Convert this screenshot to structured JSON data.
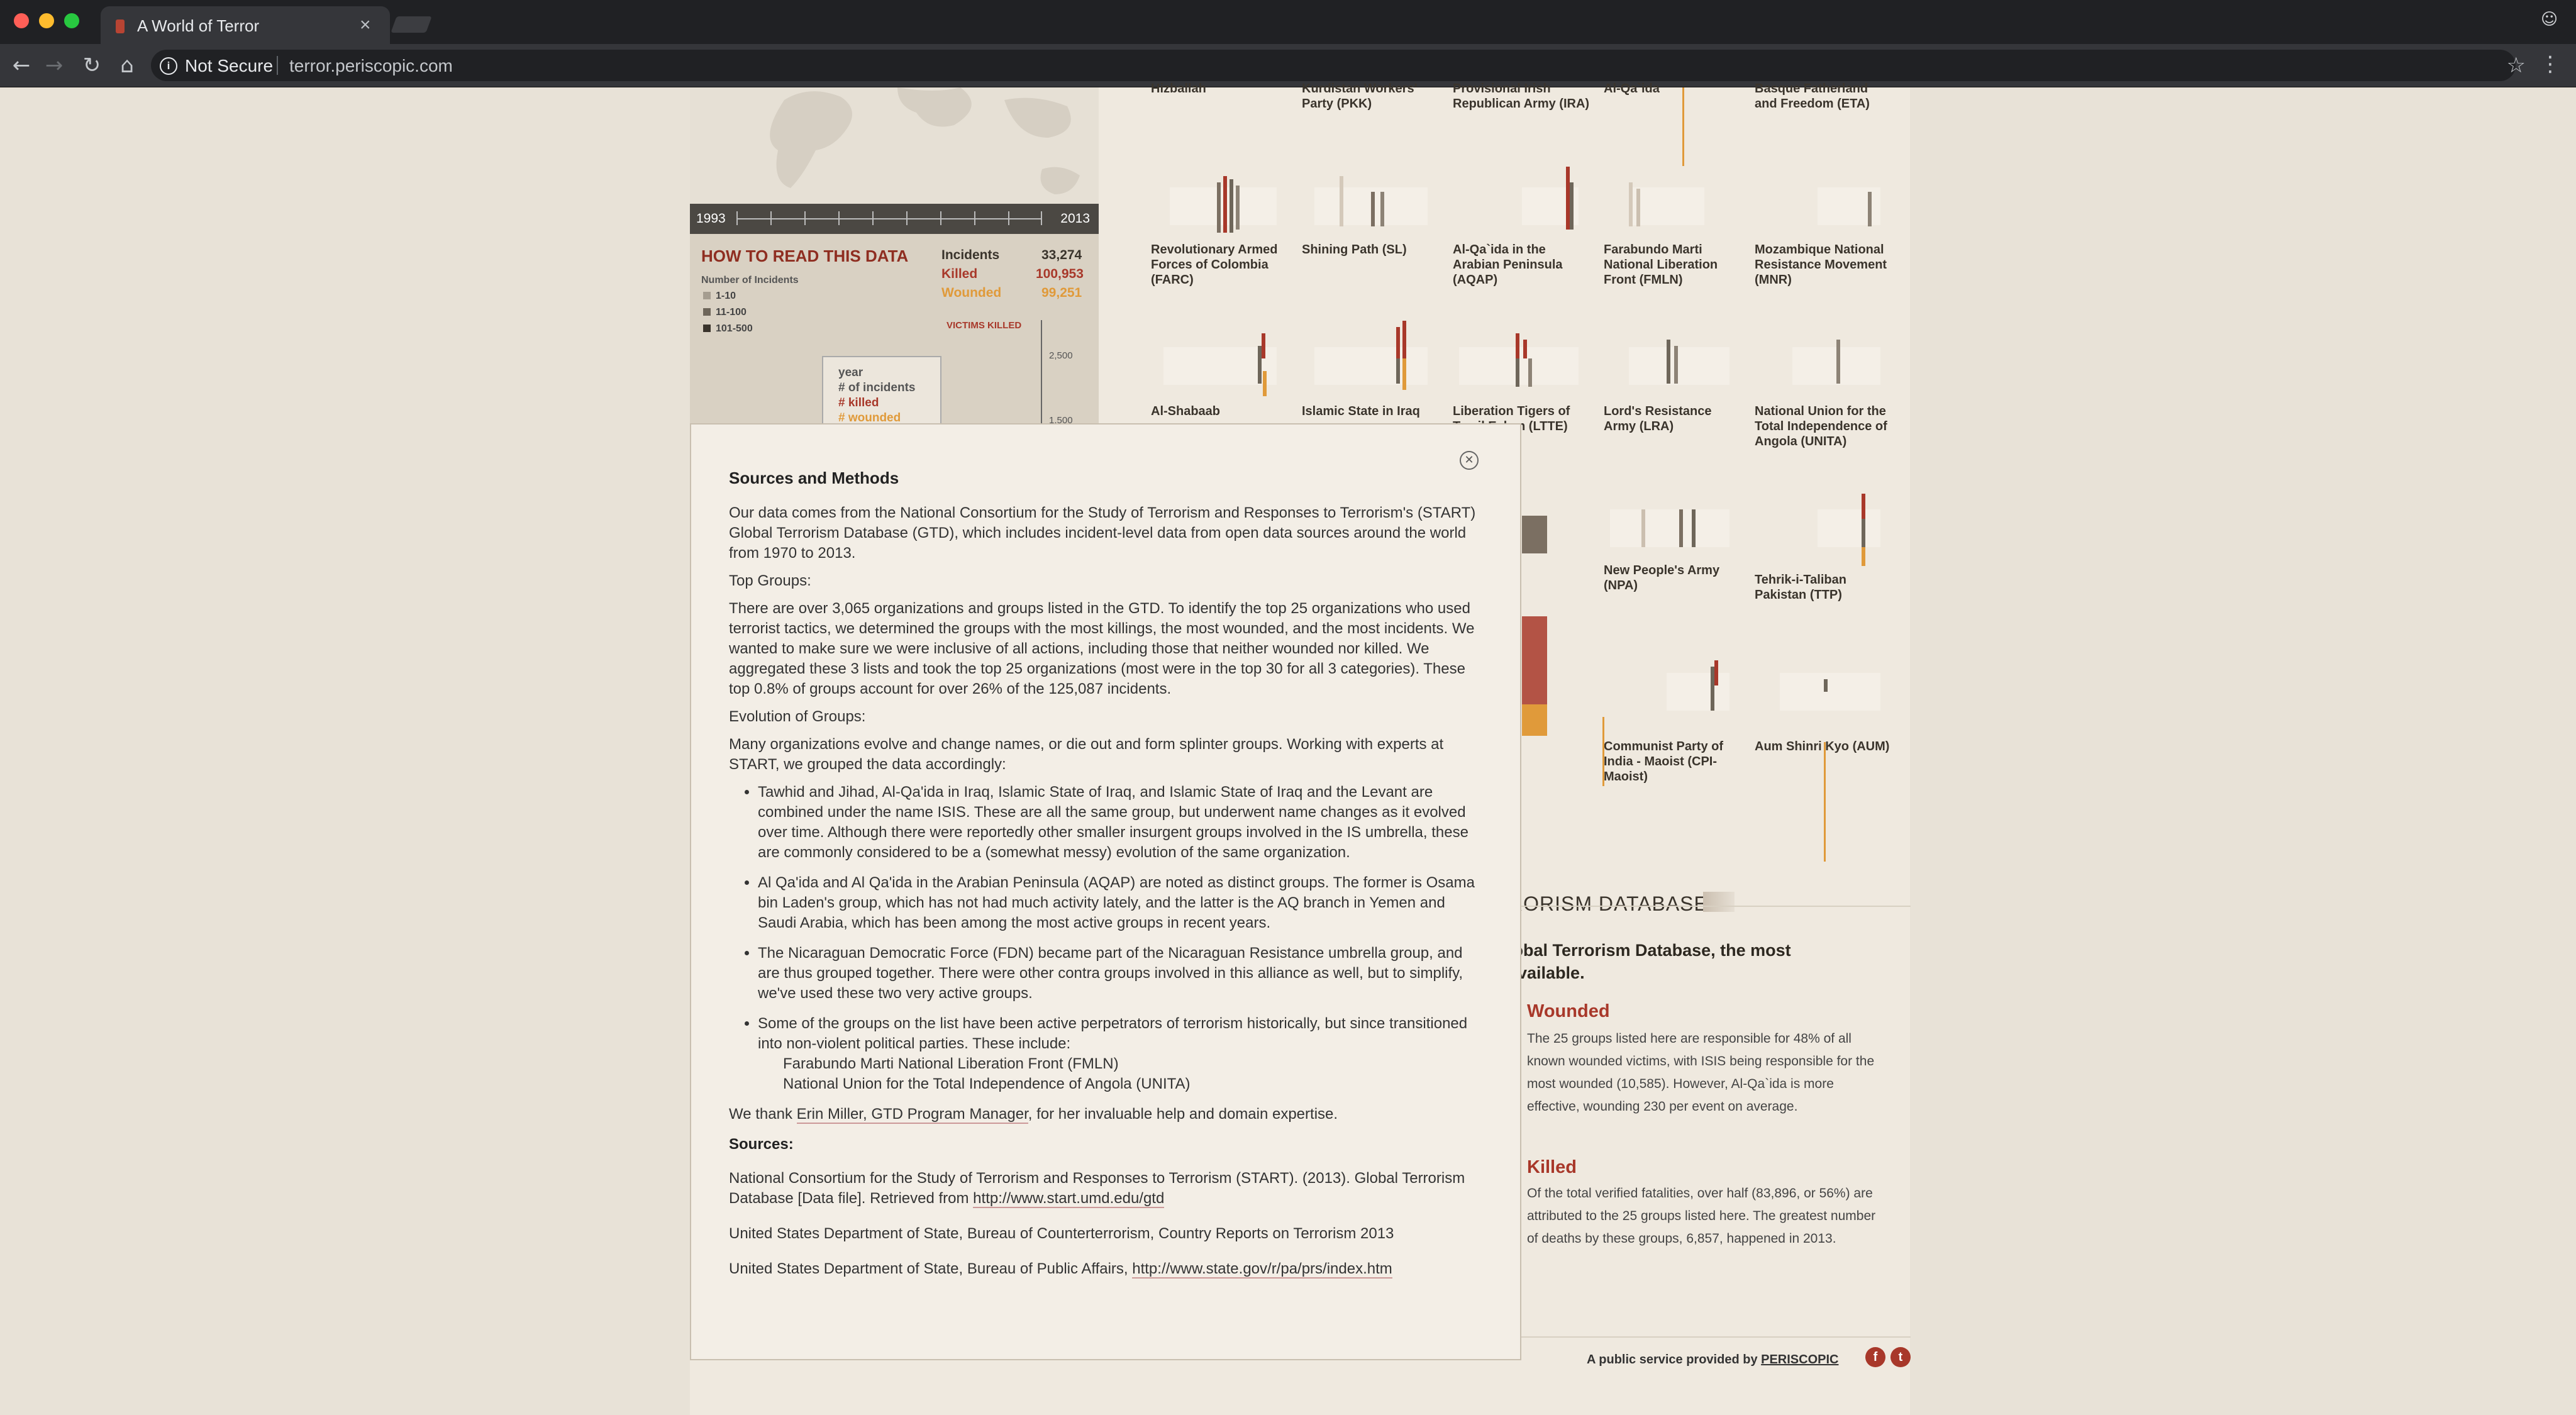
{
  "browser": {
    "tab_title": "A World of Terror",
    "security_label": "Not Secure",
    "url": "terror.periscopic.com"
  },
  "colors": {
    "accent": "#a8382a",
    "wounded": "#e09a3a",
    "dark": "#4b4843"
  },
  "sidebar": {
    "year_start": "1993",
    "year_end": "2013",
    "howto_title": "HOW TO READ THIS DATA",
    "legend_title": "Number of Incidents",
    "legend": [
      "1-10",
      "11-100",
      "101-500"
    ],
    "stats": [
      {
        "label": "Incidents",
        "value": "33,274"
      },
      {
        "label": "Killed",
        "value": "100,953"
      },
      {
        "label": "Wounded",
        "value": "99,251"
      }
    ],
    "victims_killed_label": "VICTIMS KILLED",
    "axis_ticks": [
      "2,500",
      "1,500"
    ],
    "tooltip": [
      "year",
      "# of incidents",
      "# killed",
      "# wounded"
    ]
  },
  "groups": {
    "top_row": [
      "Hizballah",
      "Kurdistan Workers' Party (PKK)",
      "Provisional Irish Republican Army (IRA)",
      "Al-Qa`ida",
      "Basque Fatherland and Freedom (ETA)"
    ],
    "row1": [
      "Revolutionary Armed Forces of Colombia (FARC)",
      "Shining Path (SL)",
      "Al-Qa`ida in the Arabian Peninsula (AQAP)",
      "Farabundo Marti National Liberation Front (FMLN)",
      "Mozambique National Resistance Movement (MNR)"
    ],
    "row2": [
      "Al-Shabaab",
      "Islamic State in Iraq",
      "Liberation Tigers of Tamil Eelam (LTTE)",
      "Lord's Resistance Army (LRA)",
      "National Union for the Total Independence of Angola (UNITA)"
    ],
    "row3": [
      "New People's Army (NPA)",
      "Tehrik-i-Taliban Pakistan (TTP)"
    ],
    "row4": [
      "Communist Party of India - Maoist (CPI-Maoist)",
      "Aum Shinri Kyo (AUM)"
    ]
  },
  "database": {
    "heading": "RORISM DATABASE",
    "lead": "lobal Terrorism Database, the most available.",
    "wounded_title": "Wounded",
    "wounded_text": "The 25 groups listed here are responsible for 48% of all known wounded victims, with ISIS being responsible for the most wounded (10,585). However, Al-Qa`ida is more effective, wounding 230 per event on average.",
    "killed_title": "Killed",
    "killed_text": "Of the total verified fatalities, over half (83,896, or 56%) are attributed to the 25 groups listed here. The greatest number of deaths by these groups, 6,857, happened in 2013."
  },
  "footer": {
    "text": "A public service provided by",
    "brand": "PERISCOPIC"
  },
  "modal": {
    "title": "Sources and Methods",
    "intro": "Our data comes from the National Consortium for the Study of Terrorism and Responses to Terrorism's (START) Global Terrorism Database (GTD), which includes incident-level data from open data sources around the world from 1970 to 2013.",
    "top_groups_heading": "Top Groups:",
    "top_groups_text": "There are over 3,065 organizations and groups listed in the GTD. To identify the top 25 organizations who used terrorist tactics, we determined the groups with the most killings, the most wounded, and the most incidents. We wanted to make sure we were inclusive of all actions, including those that neither wounded nor killed. We aggregated these 3 lists and took the top 25 organizations (most were in the top 30 for all 3 categories). These top 0.8% of groups account for over 26% of the 125,087 incidents.",
    "evolution_heading": "Evolution of Groups:",
    "evolution_text": "Many organizations evolve and change names, or die out and form splinter groups. Working with experts at START, we grouped the data accordingly:",
    "bullets": [
      "Tawhid and Jihad, Al-Qa'ida in Iraq, Islamic State of Iraq, and Islamic State of Iraq and the Levant are combined under the name ISIS. These are all the same group, but underwent name changes as it evolved over time. Although there were reportedly other smaller insurgent groups involved in the IS umbrella, these are commonly considered to be a (somewhat messy) evolution of the same organization.",
      "Al Qa'ida and Al Qa'ida in the Arabian Peninsula (AQAP) are noted as distinct groups. The former is Osama bin Laden's group, which has not had much activity lately, and the latter is the AQ branch in Yemen and Saudi Arabia, which has been among the most active groups in recent years.",
      "The Nicaraguan Democratic Force (FDN) became part of the Nicaraguan Resistance umbrella group, and are thus grouped together. There were other contra groups involved in this alliance as well, but to simplify, we've used these two very active groups.",
      "Some of the groups on the list have been active perpetrators of terrorism historically, but since transitioned into non-violent political parties. These include:"
    ],
    "sub_items": [
      "Farabundo Marti National Liberation Front (FMLN)",
      "National Union for the Total Independence of Angola (UNITA)"
    ],
    "thanks_pre": "We thank ",
    "thanks_link": "Erin Miller, GTD Program Manager",
    "thanks_post": ", for her invaluable help and domain expertise.",
    "sources_heading": "Sources:",
    "source1": "National Consortium for the Study of Terrorism and Responses to Terrorism (START). (2013). Global Terrorism Database [Data file]. Retrieved from ",
    "source1_link": "http://www.start.umd.edu/gtd",
    "source2": "United States Department of State, Bureau of Counterterrorism, Country Reports on Terrorism 2013",
    "source3": "United States Department of State, Bureau of Public Affairs, ",
    "source3_link": "http://www.state.gov/r/pa/prs/index.htm"
  }
}
